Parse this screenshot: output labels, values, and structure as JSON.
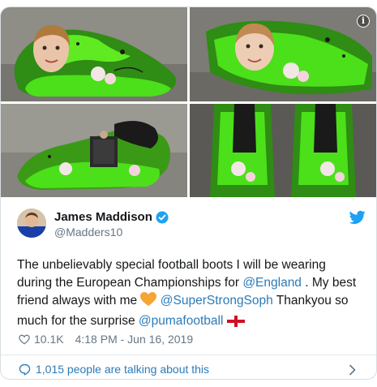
{
  "media": {
    "images": [
      {
        "alt": "football boot with girl portrait, green paint splash, side view"
      },
      {
        "alt": "football boot with girl portrait, close up"
      },
      {
        "alt": "football boot with figure holding sign"
      },
      {
        "alt": "football boots rear view with green splash"
      }
    ],
    "info_icon_glyph": "i"
  },
  "author": {
    "display_name": "James Maddison",
    "handle": "@Madders10",
    "verified": true
  },
  "tweet": {
    "text_1": "The unbelievably special football boots I will be wearing during the European Championships for ",
    "mention_1": "@England",
    "text_2": " . My best friend always with me ",
    "mention_2": "@SuperStrongSoph",
    "text_3": " Thankyou so much for the surprise ",
    "mention_3": "@pumafootball",
    "emoji_1": "orange-heart",
    "emoji_2": "england-flag"
  },
  "meta": {
    "likes": "10.1K",
    "timestamp": "4:18 PM - Jun 16, 2019"
  },
  "footer": {
    "talking_label": "1,015 people are talking about this"
  },
  "colors": {
    "link": "#2b7bb9",
    "muted": "#657786",
    "verified": "#1da1f2",
    "twitter_bird": "#1da1f2",
    "boot_green": "#4be01a"
  }
}
